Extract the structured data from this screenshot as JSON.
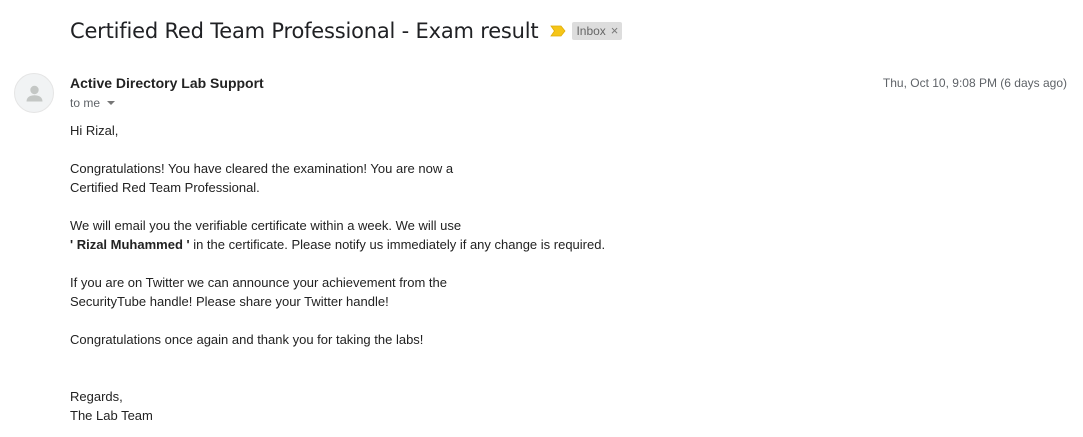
{
  "email": {
    "subject": "Certified Red Team Professional - Exam result",
    "label": "Inbox",
    "label_remove": "×",
    "sender": "Active Directory Lab Support",
    "recipient": "to me",
    "date": "Thu, Oct 10, 9:08 PM (6 days ago)",
    "body": {
      "greeting": "Hi Rizal,",
      "p1_line1": "Congratulations! You have cleared the examination! You are now a",
      "p1_line2": "Certified Red Team Professional.",
      "p2_line1": "We will email you the verifiable certificate within a week. We will use",
      "p2_name": "' Rizal Muhammed '",
      "p2_rest": " in the certificate. Please notify us immediately if any change is required.",
      "p3_line1": "If you are on Twitter we can announce your achievement from the",
      "p3_line2": "SecurityTube handle! Please share your Twitter handle!",
      "p4": "Congratulations once again and thank you for taking the labs!",
      "closing": "Regards,",
      "signature": "The Lab Team"
    }
  },
  "colors": {
    "importance_marker": "#f5c518",
    "label_chip_bg": "#dddddd"
  },
  "icons": {
    "importance": "importance-marker-icon",
    "avatar": "default-avatar-icon",
    "caret": "chevron-down-icon"
  }
}
